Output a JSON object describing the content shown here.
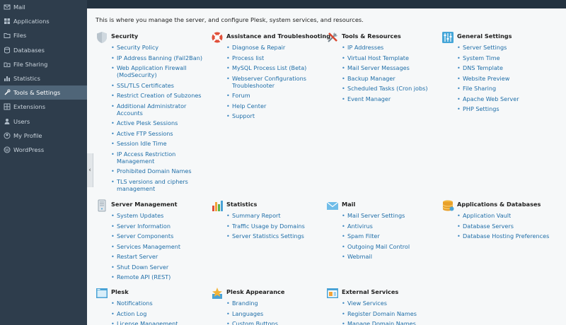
{
  "sidebar": {
    "items": [
      {
        "label": "Mail",
        "icon": "mail-icon",
        "active": false
      },
      {
        "label": "Applications",
        "icon": "applications-icon",
        "active": false
      },
      {
        "label": "Files",
        "icon": "folder-icon",
        "active": false
      },
      {
        "label": "Databases",
        "icon": "database-icon",
        "active": false
      },
      {
        "label": "File Sharing",
        "icon": "file-sharing-icon",
        "active": false
      },
      {
        "label": "Statistics",
        "icon": "statistics-icon",
        "active": false
      },
      {
        "label": "Tools & Settings",
        "icon": "tools-icon",
        "active": true
      },
      {
        "label": "Extensions",
        "icon": "extensions-icon",
        "active": false
      },
      {
        "label": "Users",
        "icon": "users-icon",
        "active": false
      },
      {
        "label": "My Profile",
        "icon": "profile-icon",
        "active": false
      },
      {
        "label": "WordPress",
        "icon": "wordpress-icon",
        "active": false
      }
    ]
  },
  "main": {
    "intro": "This is where you manage the server, and configure Plesk, system services, and resources.",
    "collapse_glyph": "‹",
    "sections": [
      {
        "title": "Security",
        "icon": "shield-icon",
        "links": [
          "Security Policy",
          "IP Address Banning (Fail2Ban)",
          "Web Application Firewall (ModSecurity)",
          "SSL/TLS Certificates",
          "Restrict Creation of Subzones",
          "Additional Administrator Accounts",
          "Active Plesk Sessions",
          "Active FTP Sessions",
          "Session Idle Time",
          "IP Access Restriction Management",
          "Prohibited Domain Names",
          "TLS versions and ciphers management"
        ]
      },
      {
        "title": "Assistance and Troubleshooting",
        "icon": "lifebuoy-icon",
        "links": [
          "Diagnose & Repair",
          "Process list",
          "MySQL Process List (Beta)",
          "Webserver Configurations Troubleshooter",
          "Forum",
          "Help Center",
          "Support"
        ]
      },
      {
        "title": "Tools & Resources",
        "icon": "tools-icon",
        "links": [
          "IP Addresses",
          "Virtual Host Template",
          "Mail Server Messages",
          "Backup Manager",
          "Scheduled Tasks (Cron jobs)",
          "Event Manager"
        ]
      },
      {
        "title": "General Settings",
        "icon": "settings-sliders-icon",
        "links": [
          "Server Settings",
          "System Time",
          "DNS Template",
          "Website Preview",
          "File Sharing",
          "Apache Web Server",
          "PHP Settings"
        ]
      },
      {
        "title": "Server Management",
        "icon": "server-icon",
        "links": [
          "System Updates",
          "Server Information",
          "Server Components",
          "Services Management",
          "Restart Server",
          "Shut Down Server",
          "Remote API (REST)"
        ]
      },
      {
        "title": "Statistics",
        "icon": "bar-chart-icon",
        "links": [
          "Summary Report",
          "Traffic Usage by Domains",
          "Server Statistics Settings"
        ]
      },
      {
        "title": "Mail",
        "icon": "envelope-icon",
        "links": [
          "Mail Server Settings",
          "Antivirus",
          "Spam Filter",
          "Outgoing Mail Control",
          "Webmail"
        ]
      },
      {
        "title": "Applications & Databases",
        "icon": "database-icon",
        "links": [
          "Application Vault",
          "Database Servers",
          "Database Hosting Preferences"
        ]
      },
      {
        "title": "Plesk",
        "icon": "plesk-window-icon",
        "links": [
          "Notifications",
          "Action Log",
          "License Management"
        ]
      },
      {
        "title": "Plesk Appearance",
        "icon": "appearance-icon",
        "links": [
          "Branding",
          "Languages",
          "Custom Buttons"
        ]
      },
      {
        "title": "External Services",
        "icon": "external-services-icon",
        "links": [
          "View Services",
          "Register Domain Names",
          "Manage Domain Names"
        ]
      }
    ]
  }
}
